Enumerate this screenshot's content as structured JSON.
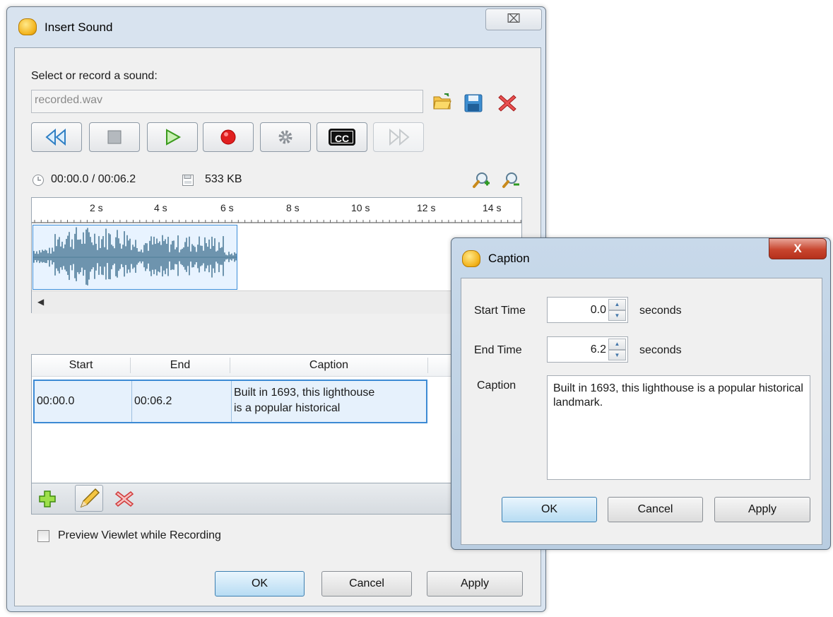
{
  "main_dialog": {
    "title": "Insert Sound",
    "close_glyph": "⌧",
    "select_label": "Select or record a sound:",
    "file_name": "recorded.wav",
    "file_icons": [
      "open-folder-icon",
      "save-disk-icon",
      "delete-x-icon"
    ],
    "transport": [
      "rewind-icon",
      "stop-icon",
      "play-icon",
      "record-icon",
      "settings-gear-icon",
      "closed-caption-icon",
      "fast-forward-icon"
    ],
    "cc_label": "CC",
    "time_display": "00:00.0 / 00:06.2",
    "size_display": "533 KB",
    "ruler_ticks": [
      "2 s",
      "4 s",
      "6 s",
      "8 s",
      "10 s",
      "12 s",
      "14 s"
    ],
    "table": {
      "headers": [
        "Start",
        "End",
        "Caption"
      ],
      "rows": [
        {
          "start": "00:00.0",
          "end": "00:06.2",
          "caption_line1": "Built in 1693, this lighthouse",
          "caption_line2": "is a popular historical"
        }
      ]
    },
    "preview_checkbox": "Preview Viewlet while Recording",
    "buttons": {
      "ok": "OK",
      "cancel": "Cancel",
      "apply": "Apply"
    }
  },
  "caption_dialog": {
    "title": "Caption",
    "close_glyph": "X",
    "start_label": "Start Time",
    "start_value": "0.0",
    "end_label": "End Time",
    "end_value": "6.2",
    "unit": "seconds",
    "caption_label": "Caption",
    "caption_text": "Built in 1693, this lighthouse is a popular historical landmark.",
    "buttons": {
      "ok": "OK",
      "cancel": "Cancel",
      "apply": "Apply"
    }
  },
  "colors": {
    "accent": "#3c8ad4",
    "wave": "#4f7d99",
    "record_red": "#e02020"
  }
}
